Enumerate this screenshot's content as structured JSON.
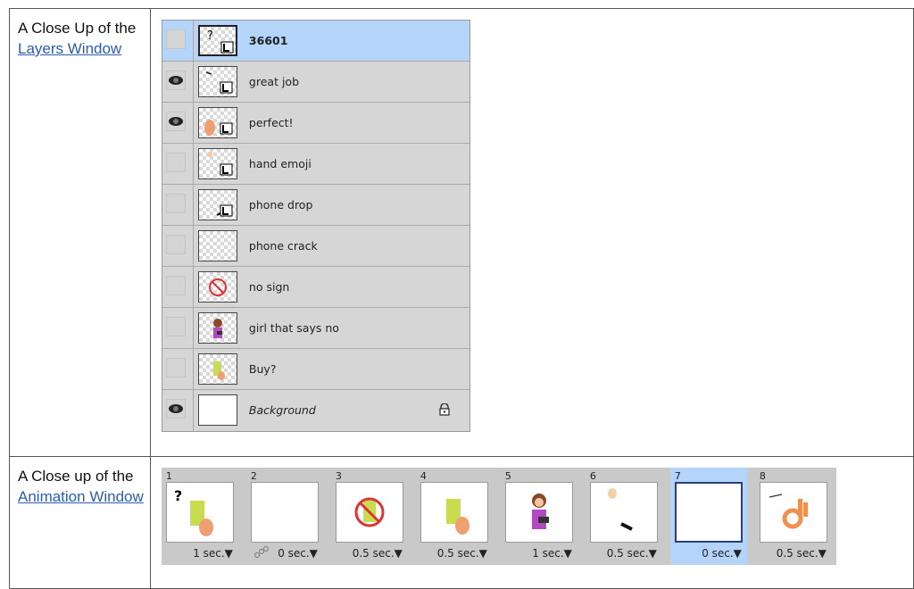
{
  "rows": [
    {
      "label_pre": "A Close Up of the ",
      "link": "Layers Window"
    },
    {
      "label_pre": "A Close up of the ",
      "link": "Animation Window"
    }
  ],
  "layers": [
    {
      "name": "36601",
      "visible": false,
      "selected": true,
      "thumb": "question-icon"
    },
    {
      "name": "great job",
      "visible": true,
      "selected": false,
      "thumb": "text-icon"
    },
    {
      "name": "perfect!",
      "visible": true,
      "selected": false,
      "thumb": "hand-icon"
    },
    {
      "name": "hand emoji",
      "visible": false,
      "selected": false,
      "thumb": "hand-icon"
    },
    {
      "name": "phone drop",
      "visible": false,
      "selected": false,
      "thumb": "phone-icon"
    },
    {
      "name": "phone crack",
      "visible": false,
      "selected": false,
      "thumb": "empty"
    },
    {
      "name": "no sign",
      "visible": false,
      "selected": false,
      "thumb": "no-sign-icon"
    },
    {
      "name": "girl that says no",
      "visible": false,
      "selected": false,
      "thumb": "girl-icon"
    },
    {
      "name": "Buy?",
      "visible": false,
      "selected": false,
      "thumb": "phone-hand-icon"
    },
    {
      "name": "Background",
      "visible": true,
      "selected": false,
      "thumb": "blank",
      "locked": true
    }
  ],
  "frames": [
    {
      "num": "1",
      "delay": "1 sec.▼",
      "selected": false
    },
    {
      "num": "2",
      "delay": "0 sec.▼",
      "selected": false
    },
    {
      "num": "3",
      "delay": "0.5 sec.▼",
      "selected": false
    },
    {
      "num": "4",
      "delay": "0.5 sec.▼",
      "selected": false
    },
    {
      "num": "5",
      "delay": "1 sec.▼",
      "selected": false
    },
    {
      "num": "6",
      "delay": "0.5 sec.▼",
      "selected": false
    },
    {
      "num": "7",
      "delay": "0 sec.▼",
      "selected": true
    },
    {
      "num": "8",
      "delay": "0.5 sec.▼",
      "selected": false
    }
  ],
  "colors": {
    "selected": "#b5d4fa",
    "link": "#2a5db0",
    "panel": "#d6d6d6"
  }
}
